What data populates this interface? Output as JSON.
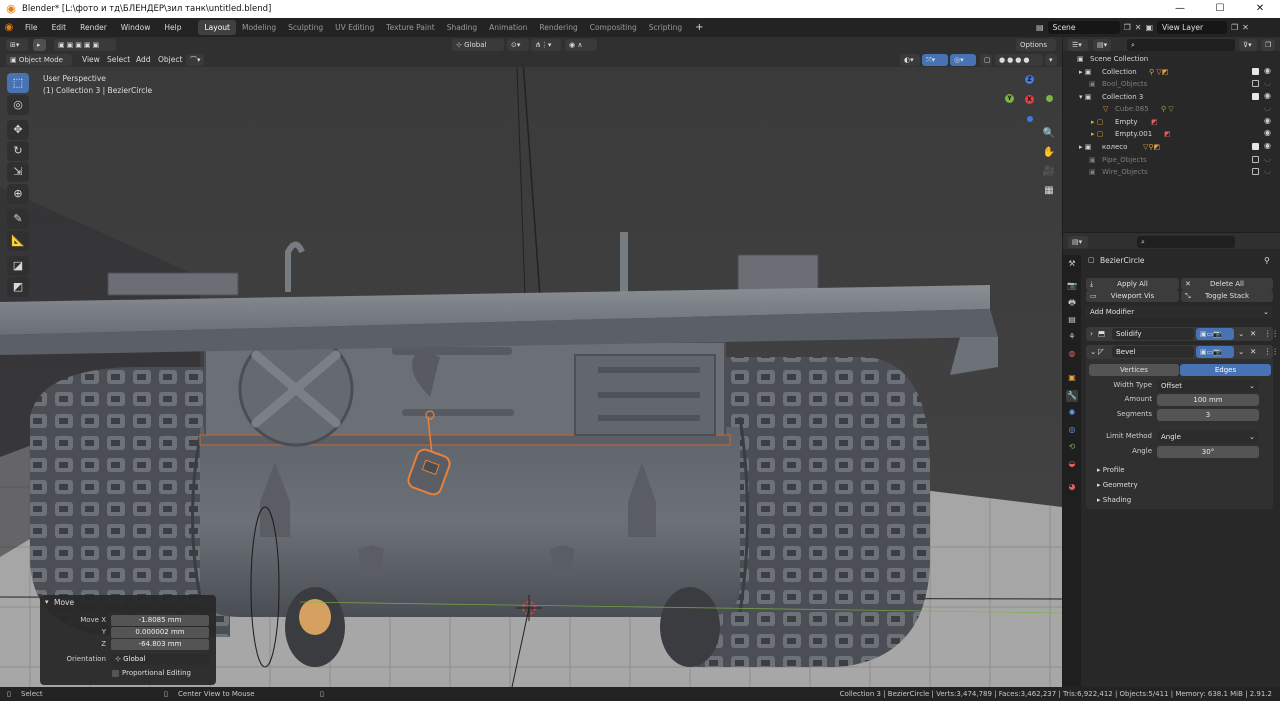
{
  "window": {
    "title": "Blender* [L:\\фото и тд\\БЛЕНДЕР\\зил танк\\untitled.blend]",
    "controls": [
      "—",
      "☐",
      "✕"
    ]
  },
  "menu": [
    "File",
    "Edit",
    "Render",
    "Window",
    "Help"
  ],
  "workspaces": [
    "Layout",
    "Modeling",
    "Sculpting",
    "UV Editing",
    "Texture Paint",
    "Shading",
    "Animation",
    "Rendering",
    "Compositing",
    "Scripting"
  ],
  "active_workspace": "Layout",
  "scene": "Scene",
  "view_layer": "View Layer",
  "viewport": {
    "mode": "Object Mode",
    "menus": [
      "View",
      "Select",
      "Add",
      "Object"
    ],
    "transform_orientation": "Global",
    "options": "Options",
    "perspective": "User Perspective",
    "active_info": "(1) Collection 3 | BezierCircle",
    "gizmo": {
      "x": "X",
      "y": "Y",
      "z": "Z"
    }
  },
  "move_panel": {
    "title": "Move",
    "fields": [
      {
        "label": "Move X",
        "value": "-1.8085 mm"
      },
      {
        "label": "Y",
        "value": "0.000002 mm"
      },
      {
        "label": "Z",
        "value": "-64.803 mm"
      }
    ],
    "orientation_label": "Orientation",
    "orientation_value": "Global",
    "proportional": "Proportional Editing"
  },
  "outliner": {
    "root": "Scene Collection",
    "items": [
      {
        "name": "Collection",
        "dim": false,
        "checked": true
      },
      {
        "name": "Bool_Objects",
        "dim": true,
        "checked": false
      },
      {
        "name": "Collection 3",
        "dim": false,
        "checked": true
      },
      {
        "name": "Cube.085",
        "dim": true,
        "checked": false
      },
      {
        "name": "Empty",
        "dim": false,
        "checked": false
      },
      {
        "name": "Empty.001",
        "dim": false,
        "checked": false
      },
      {
        "name": "колесо",
        "dim": false,
        "checked": true
      },
      {
        "name": "Pipe_Objects",
        "dim": true,
        "checked": false
      },
      {
        "name": "Wire_Objects",
        "dim": true,
        "checked": false
      }
    ]
  },
  "properties": {
    "object": "BezierCircle",
    "apply_all": "Apply All",
    "delete_all": "Delete All",
    "viewport_vis": "Viewport Vis",
    "toggle_stack": "Toggle Stack",
    "add_modifier": "Add Modifier",
    "modifiers": [
      "Solidify",
      "Bevel"
    ],
    "bevel": {
      "affect_tabs": [
        "Vertices",
        "Edges"
      ],
      "active_tab": "Edges",
      "width_type_label": "Width Type",
      "width_type": "Offset",
      "amount_label": "Amount",
      "amount": "100 mm",
      "segments_label": "Segments",
      "segments": "3",
      "limit_method_label": "Limit Method",
      "limit_method": "Angle",
      "angle_label": "Angle",
      "angle": "30°",
      "subpanels": [
        "Profile",
        "Geometry",
        "Shading"
      ]
    }
  },
  "statusbar": {
    "select": "Select",
    "center": "Center View to Mouse",
    "stats": "Collection 3 | BezierCircle | Verts:3,474,789 | Faces:3,462,237 | Tris:6,922,412 | Objects:5/411 | Memory: 638.1 MiB | 2.91.2"
  },
  "colors": {
    "accent": "#4772b3",
    "selection": "#e8813a",
    "titlebar": "#ffffff",
    "panel": "#282828"
  }
}
